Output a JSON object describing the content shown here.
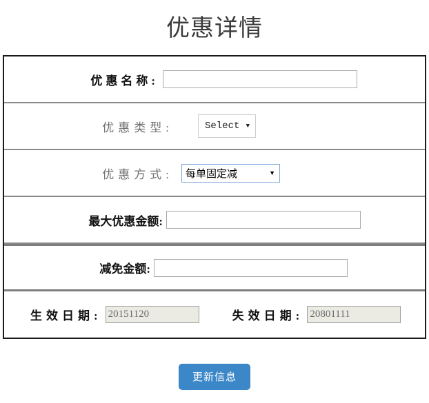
{
  "page": {
    "title": "优惠详情"
  },
  "form": {
    "rows": [
      {
        "label": "优惠名称:",
        "control": "text",
        "value": "",
        "placeholder": ""
      },
      {
        "label": "优惠类型:",
        "control": "select-plain",
        "value": "Select",
        "caret": "▼"
      },
      {
        "label": "优惠方式:",
        "control": "select-native",
        "value": "每单固定减",
        "caret": "▼"
      },
      {
        "label": "最大优惠金额:",
        "control": "text",
        "value": "",
        "placeholder": ""
      },
      {
        "label": "减免金额:",
        "control": "text",
        "value": "",
        "placeholder": ""
      }
    ],
    "dates": {
      "start_label": "生效日期:",
      "start_value": "20151120",
      "end_label": "失效日期:",
      "end_value": "20801111"
    }
  },
  "footer": {
    "submit_label": "更新信息"
  },
  "colors": {
    "button_blue": "#3b87c8",
    "select_focus_border": "#7da7d9",
    "disabled_input_bg": "#ebebe4",
    "table_border": "#1a1a1a",
    "row_divider": "#8a8a8a",
    "title_text": "#3b3b3b",
    "grey_label": "#6f6f6f"
  }
}
